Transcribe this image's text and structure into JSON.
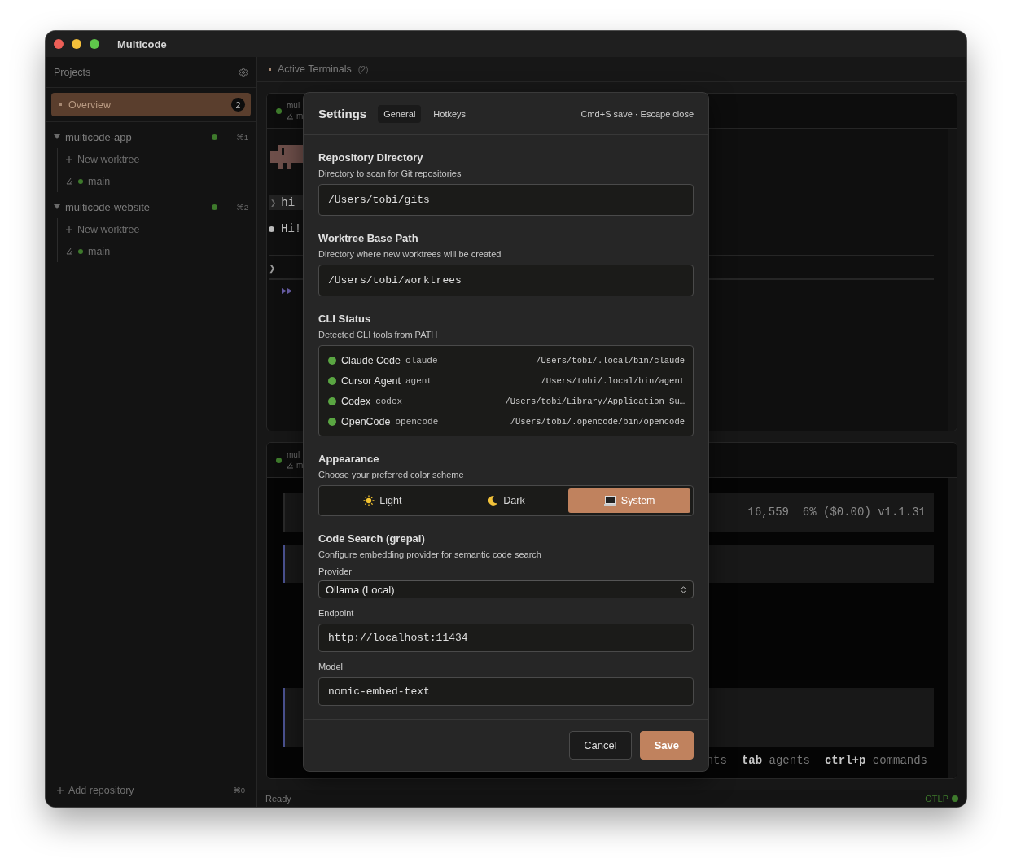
{
  "window": {
    "title": "Multicode"
  },
  "sidebar": {
    "title": "Projects",
    "overview": {
      "label": "Overview",
      "badge": "2",
      "selected": true
    },
    "projects": [
      {
        "name": "multicode-app",
        "shortcut": "⌘1",
        "expanded": true,
        "children": [
          {
            "kind": "action",
            "label": "New worktree"
          },
          {
            "kind": "branch",
            "label": "main"
          }
        ]
      },
      {
        "name": "multicode-website",
        "shortcut": "⌘2",
        "expanded": true,
        "children": [
          {
            "kind": "action",
            "label": "New worktree"
          },
          {
            "kind": "branch",
            "label": "main"
          }
        ]
      }
    ],
    "add_repository": {
      "label": "Add repository",
      "shortcut": "⌘0"
    }
  },
  "main": {
    "title": "Active Terminals",
    "count": "(2)",
    "terminals": [
      {
        "kind": "chat",
        "name": "mul",
        "branch": "m",
        "prompt_marker": "❯",
        "prompt": "hi",
        "reply": "Hi!",
        "input_marker": "❯"
      },
      {
        "kind": "status",
        "name": "mul",
        "branch": "m",
        "statusline": "16,559  6% ($0.00) v1.1.31",
        "hints": [
          {
            "label": "nts"
          },
          {
            "key": "tab",
            "label": "agents"
          },
          {
            "key": "ctrl+p",
            "label": "commands"
          }
        ]
      }
    ]
  },
  "status_bar": {
    "left": "Ready",
    "right": "OTLP"
  },
  "settings": {
    "title": "Settings",
    "tabs": [
      {
        "label": "General",
        "selected": true
      },
      {
        "label": "Hotkeys",
        "selected": false
      }
    ],
    "shortcut_hint": "Cmd+S save · Escape close",
    "repository_directory": {
      "title": "Repository Directory",
      "description": "Directory to scan for Git repositories",
      "value": "/Users/tobi/gits"
    },
    "worktree_base_path": {
      "title": "Worktree Base Path",
      "description": "Directory where new worktrees will be created",
      "value": "/Users/tobi/worktrees"
    },
    "cli_status": {
      "title": "CLI Status",
      "description": "Detected CLI tools from PATH",
      "tools": [
        {
          "name": "Claude Code",
          "command": "claude",
          "path": "/Users/tobi/.local/bin/claude",
          "installed": true
        },
        {
          "name": "Cursor Agent",
          "command": "agent",
          "path": "/Users/tobi/.local/bin/agent",
          "installed": true
        },
        {
          "name": "Codex",
          "command": "codex",
          "path": "/Users/tobi/Library/Application Su…",
          "installed": true
        },
        {
          "name": "OpenCode",
          "command": "opencode",
          "path": "/Users/tobi/.opencode/bin/opencode",
          "installed": true
        }
      ]
    },
    "appearance": {
      "title": "Appearance",
      "description": "Choose your preferred color scheme",
      "options": [
        {
          "label": "Light",
          "selected": false
        },
        {
          "label": "Dark",
          "selected": false
        },
        {
          "label": "System",
          "selected": true
        }
      ]
    },
    "code_search": {
      "title": "Code Search (grepai)",
      "description": "Configure embedding provider for semantic code search",
      "fields": [
        {
          "kind": "select",
          "label": "Provider",
          "value": "Ollama (Local)"
        },
        {
          "kind": "input",
          "label": "Endpoint",
          "value": "http://localhost:11434"
        },
        {
          "kind": "input",
          "label": "Model",
          "value": "nomic-embed-text"
        }
      ]
    },
    "buttons": [
      {
        "kind": "secondary",
        "label": "Cancel"
      },
      {
        "kind": "primary",
        "label": "Save"
      }
    ]
  }
}
